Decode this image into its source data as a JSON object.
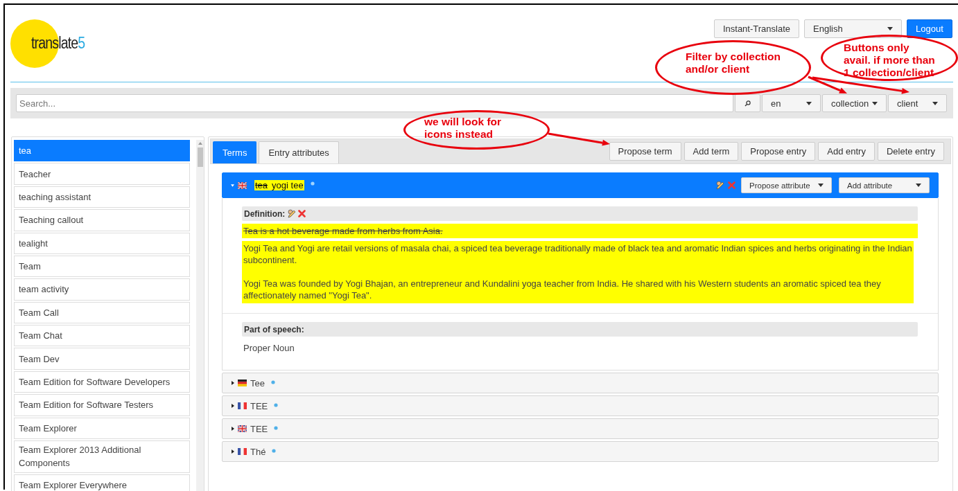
{
  "logo": {
    "text": "translate",
    "accent": "5"
  },
  "header": {
    "instant_translate": "Instant-Translate",
    "language": "English",
    "logout": "Logout"
  },
  "search": {
    "placeholder": "Search...",
    "language": "en",
    "collection": "collection",
    "client": "client"
  },
  "term_list": {
    "items": [
      {
        "label": "tea",
        "selected": true
      },
      {
        "label": "Teacher",
        "selected": false
      },
      {
        "label": "teaching assistant",
        "selected": false
      },
      {
        "label": "Teaching callout",
        "selected": false
      },
      {
        "label": "tealight",
        "selected": false
      },
      {
        "label": "Team",
        "selected": false
      },
      {
        "label": "team activity",
        "selected": false
      },
      {
        "label": "Team Call",
        "selected": false
      },
      {
        "label": "Team Chat",
        "selected": false
      },
      {
        "label": "Team Dev",
        "selected": false
      },
      {
        "label": "Team Edition for Software Developers",
        "selected": false
      },
      {
        "label": "Team Edition for Software Testers",
        "selected": false
      },
      {
        "label": "Team Explorer",
        "selected": false
      },
      {
        "label": "Team Explorer 2013 Additional Components",
        "selected": false
      },
      {
        "label": "Team Explorer Everywhere",
        "selected": false
      }
    ]
  },
  "tabs": [
    {
      "label": "Terms",
      "selected": true
    },
    {
      "label": "Entry attributes",
      "selected": false
    }
  ],
  "entry_actions": [
    "Propose term",
    "Add term",
    "Propose entry",
    "Add entry",
    "Delete entry"
  ],
  "terms": [
    {
      "flag": {
        "kind": "uk"
      },
      "expanded": true,
      "changed": true,
      "deleted_text": "tea",
      "text": "yogi tee",
      "actions": [
        "Propose attribute",
        "Add attribute"
      ],
      "attributes": [
        {
          "label": "Definition:",
          "editable": true,
          "changed": true,
          "deleted_value": "Tea is a hot beverage made from herbs from Asia.",
          "values": [
            "Yogi Tea and Yogi are retail versions of masala chai, a spiced tea beverage traditionally made of black tea and aromatic Indian spices and herbs originating in the Indian subcontinent.",
            "Yogi Tea was founded by Yogi Bhajan, an entrepreneur and Kundalini yoga teacher from India. He shared with his Western students an aromatic spiced tea they affectionately named \"Yogi Tea\"."
          ]
        },
        {
          "label": "Part of speech:",
          "editable": false,
          "changed": false,
          "values": [
            "Proper Noun"
          ]
        }
      ]
    },
    {
      "flag": {
        "kind": "de"
      },
      "expanded": false,
      "changed": false,
      "text": "Tee"
    },
    {
      "flag": {
        "kind": "fr"
      },
      "expanded": false,
      "changed": false,
      "text": "TEE"
    },
    {
      "flag": {
        "kind": "uk"
      },
      "expanded": false,
      "changed": false,
      "text": "TEE"
    },
    {
      "flag": {
        "kind": "fr"
      },
      "expanded": false,
      "changed": false,
      "text": "Thé"
    }
  ],
  "annotations": [
    {
      "lines": [
        "Filter by collection",
        "and/or client"
      ]
    },
    {
      "lines": [
        "Buttons only",
        "avail. if more than",
        "1 collection/client"
      ]
    },
    {
      "lines": [
        "we will look for",
        "icons instead"
      ]
    }
  ]
}
